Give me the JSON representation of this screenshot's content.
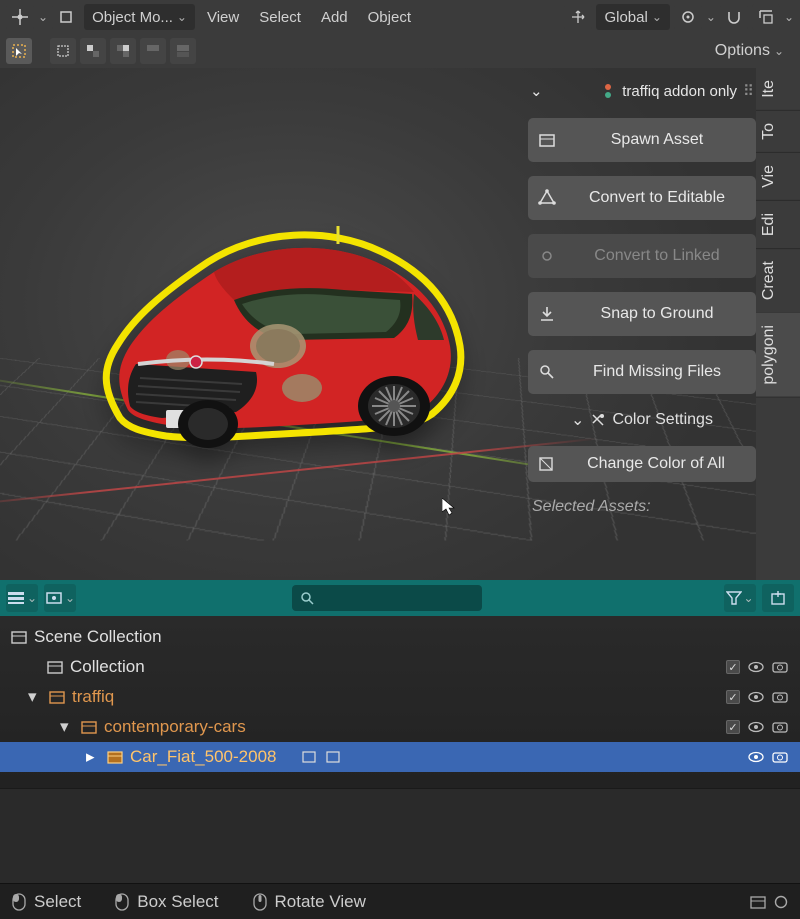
{
  "topbar": {
    "mode_label": "Object Mo...",
    "menus": [
      "View",
      "Select",
      "Add",
      "Object"
    ],
    "orientation": "Global"
  },
  "toolbar": {
    "options_label": "Options"
  },
  "panel": {
    "title": "traffiq addon only",
    "actions": {
      "spawn": "Spawn Asset",
      "convert_editable": "Convert to Editable",
      "convert_linked": "Convert to Linked",
      "snap": "Snap to Ground",
      "find_missing": "Find Missing Files"
    },
    "color_section": "Color Settings",
    "change_color": "Change Color of All",
    "selected_assets": "Selected Assets:"
  },
  "sidetabs": [
    "Ite",
    "To",
    "Vie",
    "Edi",
    "Creat",
    "polygoni"
  ],
  "outliner": {
    "scene": "Scene Collection",
    "items": [
      {
        "label": "Collection",
        "depth": 1,
        "expandable": false,
        "orange": false,
        "selected": false,
        "toggles": true
      },
      {
        "label": "traffiq",
        "depth": 1,
        "expandable": true,
        "orange": true,
        "selected": false,
        "toggles": true
      },
      {
        "label": "contemporary-cars",
        "depth": 2,
        "expandable": true,
        "orange": true,
        "selected": false,
        "toggles": true
      },
      {
        "label": "Car_Fiat_500-2008",
        "depth": 3,
        "expandable": true,
        "orange": true,
        "selected": true,
        "toggles": false
      }
    ]
  },
  "statusbar": {
    "select": "Select",
    "box_select": "Box Select",
    "rotate": "Rotate View"
  }
}
